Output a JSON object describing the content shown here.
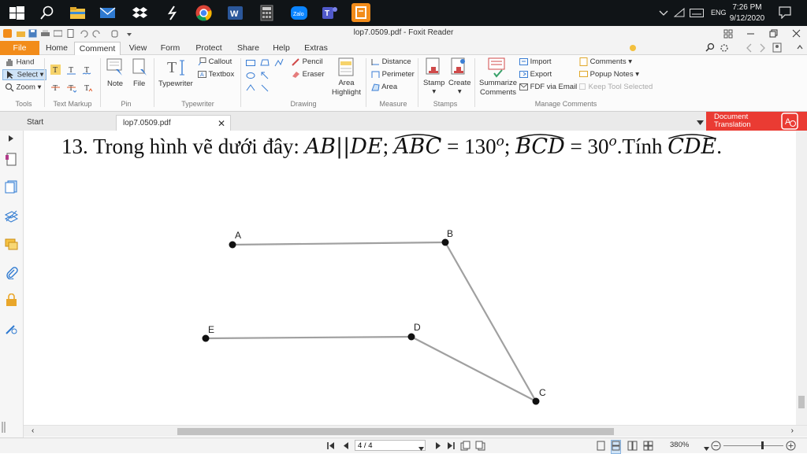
{
  "taskbar": {
    "apps": [
      "start-icon",
      "search-icon",
      "file-explorer-icon",
      "mail-icon",
      "dropbox-icon",
      "lightning-app-icon",
      "chrome-icon",
      "word-icon",
      "calculator-icon",
      "zalo-icon",
      "teams-icon",
      "foxit-icon"
    ],
    "zalo_label": "Zalo",
    "word_label": "W",
    "language": "ENG",
    "time": "7:26 PM",
    "date": "9/12/2020"
  },
  "window": {
    "title": "lop7.0509.pdf - Foxit Reader"
  },
  "ribbon_tabs": [
    "File",
    "Home",
    "Comment",
    "View",
    "Form",
    "Protect",
    "Share",
    "Help",
    "Extras"
  ],
  "active_tab": "Comment",
  "search": {
    "placeholder": "Find"
  },
  "ribbon": {
    "tools": {
      "hand": "Hand",
      "select": "Select",
      "zoom": "Zoom",
      "group": "Tools"
    },
    "text_markup": {
      "group": "Text Markup"
    },
    "pin": {
      "note": "Note",
      "file": "File",
      "group": "Pin"
    },
    "typewriter": {
      "typewriter": "Typewriter",
      "callout": "Callout",
      "textbox": "Textbox",
      "group": "Typewriter"
    },
    "drawing": {
      "pencil": "Pencil",
      "eraser": "Eraser",
      "area_highlight_1": "Area",
      "area_highlight_2": "Highlight",
      "group": "Drawing"
    },
    "measure": {
      "distance": "Distance",
      "perimeter": "Perimeter",
      "area": "Area",
      "group": "Measure"
    },
    "stamps": {
      "stamp": "Stamp",
      "create": "Create",
      "group": "Stamps"
    },
    "manage": {
      "summarize_1": "Summarize",
      "summarize_2": "Comments",
      "import": "Import",
      "export": "Export",
      "fdf": "FDF via Email",
      "comments": "Comments",
      "popup": "Popup Notes",
      "keep": "Keep Tool Selected",
      "group": "Manage Comments"
    }
  },
  "doc_tabs": [
    "Start",
    "lop7.0509.pdf"
  ],
  "translation_button": {
    "line1": "Document",
    "line2": "Translation"
  },
  "document": {
    "problem_number": "13.",
    "problem_text": "Trong hình vẽ dưới đây:",
    "math_1": "AB||DE",
    "math_2": "ABC",
    "val_2": "= 130",
    "math_3": "BCD",
    "val_3": "= 30",
    "deg": "o",
    "tinh": ".Tính",
    "math_4": "CDE",
    "figure_points": [
      {
        "label": "A"
      },
      {
        "label": "B"
      },
      {
        "label": "C"
      },
      {
        "label": "D"
      },
      {
        "label": "E"
      }
    ]
  },
  "status": {
    "page": "4 / 4",
    "zoom": "380%"
  }
}
